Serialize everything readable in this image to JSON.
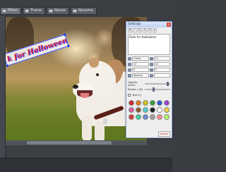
{
  "toolbar": {
    "items": [
      {
        "label": "Effect",
        "icon": "effect-icon"
      },
      {
        "label": "Frame",
        "icon": "frame-icon"
      },
      {
        "label": "Resize",
        "icon": "resize-icon"
      },
      {
        "label": "Rename",
        "icon": "rename-icon"
      }
    ]
  },
  "canvas": {
    "overlay_text": "k for Halloween"
  },
  "panel": {
    "title": "Settings",
    "close_label": "x",
    "text_value": "Dark for Halloween",
    "format_buttons": [
      "B",
      "I",
      "U",
      "S",
      "A",
      "a"
    ],
    "props": [
      {
        "left": "Comic",
        "right": "12"
      },
      {
        "left": "12",
        "right": "12"
      },
      {
        "left": "0",
        "right": "0"
      },
      {
        "left": "Normal",
        "right": ""
      }
    ],
    "opacity_label": "Opacity (85%)",
    "rotate_label": "Rotate (-18)",
    "shadow_label": "Text (1)",
    "opacity": 0.85,
    "rotate": 0.3,
    "footer_left": "",
    "footer_right": "Delete"
  },
  "colors": {
    "swatches": [
      "#cc2b2b",
      "#e07a1f",
      "#d1c020",
      "#3a9d3a",
      "#2b5bd1",
      "#9a3bd1",
      "#e05ba0",
      "#8b5a2b",
      "#4ad0d0",
      "#1f1f1f",
      "#ffffff",
      "#f0d040",
      "#d13b3b",
      "#3bd1a0",
      "#6a8ad1",
      "#a0a0a0",
      "#ff8c8c",
      "#b0ff6a"
    ]
  }
}
